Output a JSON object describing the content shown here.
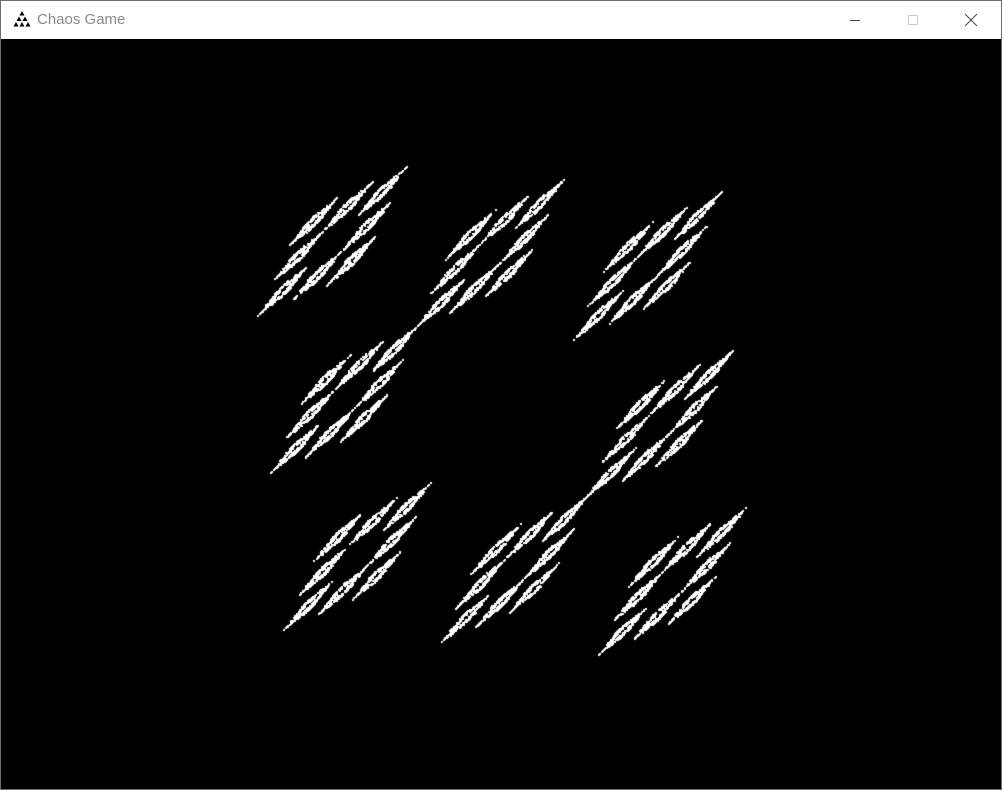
{
  "window": {
    "title": "Chaos Game",
    "app_icon": "sierpinski-triangle-icon",
    "controls": {
      "minimize_icon": "minimize-icon",
      "maximize_icon": "maximize-icon",
      "close_icon": "close-icon"
    }
  },
  "colors": {
    "canvas_background": "#000000",
    "fractal_points": "#ffffff",
    "title_text": "#8a8a8a",
    "titlebar_background": "#ffffff"
  },
  "fractal": {
    "type": "chaos-game",
    "shape": "cross-square fractal"
  }
}
